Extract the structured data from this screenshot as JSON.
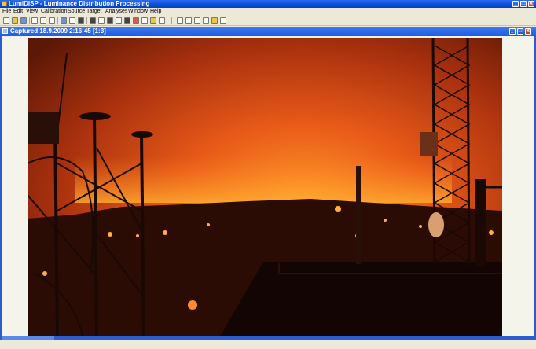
{
  "app": {
    "title": "LumiDISP - Luminance Distribution Processing",
    "icon": "sun-icon"
  },
  "window_controls": {
    "minimize": "_",
    "maximize": "□",
    "close": "x"
  },
  "menu": [
    "File",
    "Edit",
    "View",
    "Calibration",
    "Source",
    "Target",
    "Analyses",
    "Window",
    "Help"
  ],
  "toolbar_icons": [
    "new-icon",
    "open-icon",
    "save-icon",
    "cut-icon",
    "copy-icon",
    "paste-icon",
    "grid-icon",
    "table-icon",
    "histogram-icon",
    "image-icon",
    "map-icon",
    "chart-icon",
    "camera-icon",
    "sky-icon",
    "print-icon",
    "select-arrow-icon",
    "zoom-icon",
    "rectangle-icon",
    "ellipse-icon",
    "pen-icon",
    "line-icon"
  ],
  "child_window": {
    "title": "Captured 18.9.2009 2:16:45 [1:3]",
    "icon": "image-icon"
  },
  "colors": {
    "titlebar": "#0a4cd6",
    "mdi_background": "#2c5bd0",
    "sky_glow": "#e0541a"
  }
}
